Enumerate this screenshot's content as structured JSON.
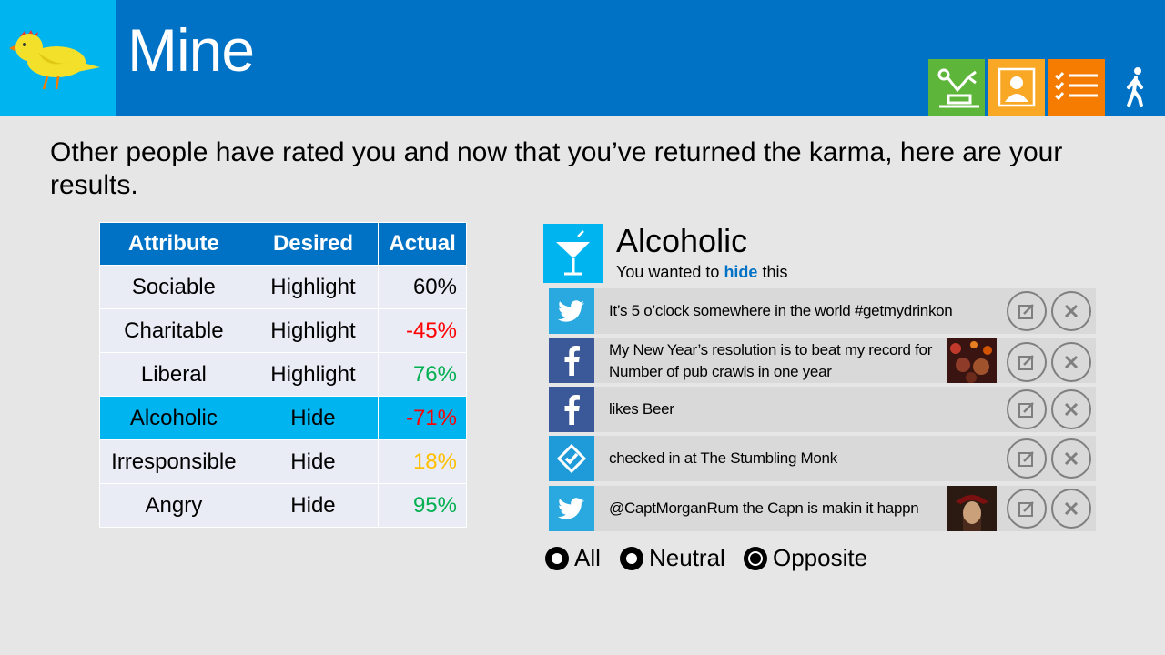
{
  "app": {
    "title": "Mine"
  },
  "header_tiles": [
    "robot-arm-icon",
    "person-icon",
    "checklist-icon",
    "walking-person-icon"
  ],
  "intro": "Other people have rated you and now that you’ve returned the karma, here are your results.",
  "table": {
    "headers": [
      "Attribute",
      "Desired",
      "Actual"
    ],
    "rows": [
      {
        "attribute": "Sociable",
        "desired": "Highlight",
        "actual": "60%"
      },
      {
        "attribute": "Charitable",
        "desired": "Highlight",
        "actual": "-45%"
      },
      {
        "attribute": "Liberal",
        "desired": "Highlight",
        "actual": "76%"
      },
      {
        "attribute": "Alcoholic",
        "desired": "Hide",
        "actual": "-71%"
      },
      {
        "attribute": "Irresponsible",
        "desired": "Hide",
        "actual": "18%"
      },
      {
        "attribute": "Angry",
        "desired": "Hide",
        "actual": "95%"
      }
    ],
    "selected_row": "Alcoholic"
  },
  "detail": {
    "title": "Alcoholic",
    "subtitle_pre": "You wanted to ",
    "subtitle_highlight": "hide",
    "subtitle_post": " this"
  },
  "feed": [
    {
      "source": "twitter",
      "text": "It’s 5 o’clock somewhere in the world #getmydrinkon",
      "has_thumb": false
    },
    {
      "source": "facebook",
      "text": "My New Year’s resolution is to beat my record for Number of pub crawls in one year",
      "has_thumb": true
    },
    {
      "source": "facebook",
      "text": "likes Beer",
      "has_thumb": false
    },
    {
      "source": "foursquare",
      "text": "checked in at The Stumbling Monk",
      "has_thumb": false
    },
    {
      "source": "twitter",
      "text": "@CaptMorganRum the Capn is makin it happn",
      "has_thumb": true
    }
  ],
  "filters": {
    "options": [
      "All",
      "Neutral",
      "Opposite"
    ],
    "selected": "Opposite"
  },
  "colors": {
    "header_blue": "#0072c6",
    "accent_cyan": "#00b4f0",
    "negative": "#ff0000",
    "positive": "#00b050",
    "warning": "#ffc000"
  }
}
